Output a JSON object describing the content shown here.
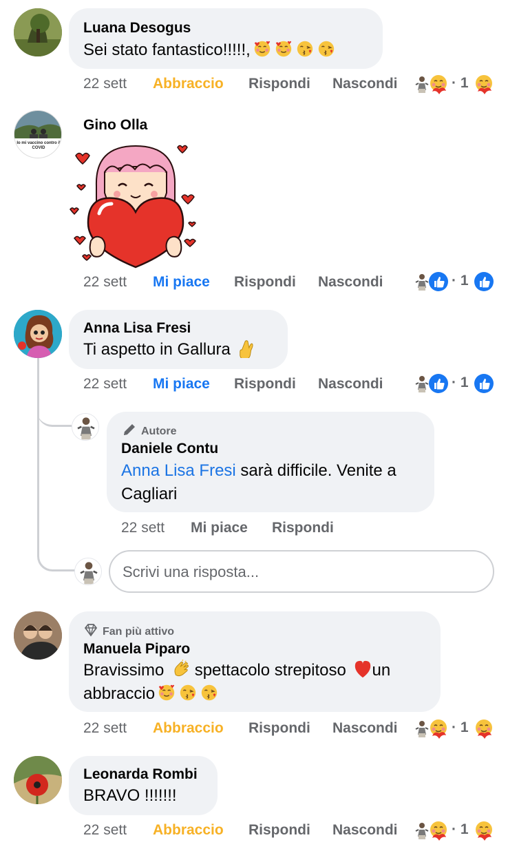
{
  "comments": [
    {
      "author": "Luana Desogus",
      "text": "Sei stato fantastico!!!!!,",
      "time": "22 sett",
      "reaction_label": "Abbraccio",
      "reply_label": "Rispondi",
      "hide_label": "Nascondi",
      "reaction_count": "· 1"
    },
    {
      "author": "Gino Olla",
      "avatar_text": "Io mi vaccino contro il COVID",
      "time": "22 sett",
      "reaction_label": "Mi piace",
      "reply_label": "Rispondi",
      "hide_label": "Nascondi",
      "reaction_count": "· 1"
    },
    {
      "author": "Anna Lisa Fresi",
      "text": "Ti aspetto in Gallura",
      "time": "22 sett",
      "reaction_label": "Mi piace",
      "reply_label": "Rispondi",
      "hide_label": "Nascondi",
      "reaction_count": "· 1"
    },
    {
      "author": "Manuela Piparo",
      "badge": "Fan più attivo",
      "text_line1_a": "Bravissimo",
      "text_line1_b": "spettacolo strepitoso",
      "text_line1_c": "un",
      "text_line2": "abbraccio",
      "time": "22 sett",
      "reaction_label": "Abbraccio",
      "reply_label": "Rispondi",
      "hide_label": "Nascondi",
      "reaction_count": "· 1"
    },
    {
      "author": "Leonarda Rombi",
      "text": "BRAVO !!!!!!!",
      "time": "22 sett",
      "reaction_label": "Abbraccio",
      "reply_label": "Rispondi",
      "hide_label": "Nascondi",
      "reaction_count": "· 1"
    }
  ],
  "reply": {
    "badge": "Autore",
    "author": "Daniele Contu",
    "mention": "Anna Lisa Fresi",
    "text_line1": "sarà difficile. Venite a",
    "text_line2": "Cagliari",
    "time": "22 sett",
    "like_label": "Mi piace",
    "reply_label": "Rispondi"
  },
  "reply_input": {
    "placeholder": "Scrivi una risposta..."
  },
  "colors": {
    "bubble": "#f0f2f5",
    "hug": "#f7b125",
    "like": "#1877f2",
    "meta": "#65676b",
    "mention": "#1b74e4"
  },
  "icons": [
    "hug-emoji-icon",
    "kiss-emoji-icon",
    "crossed-fingers-icon",
    "clap-icon",
    "red-heart-icon",
    "like-icon",
    "pen-icon",
    "diamond-icon"
  ]
}
